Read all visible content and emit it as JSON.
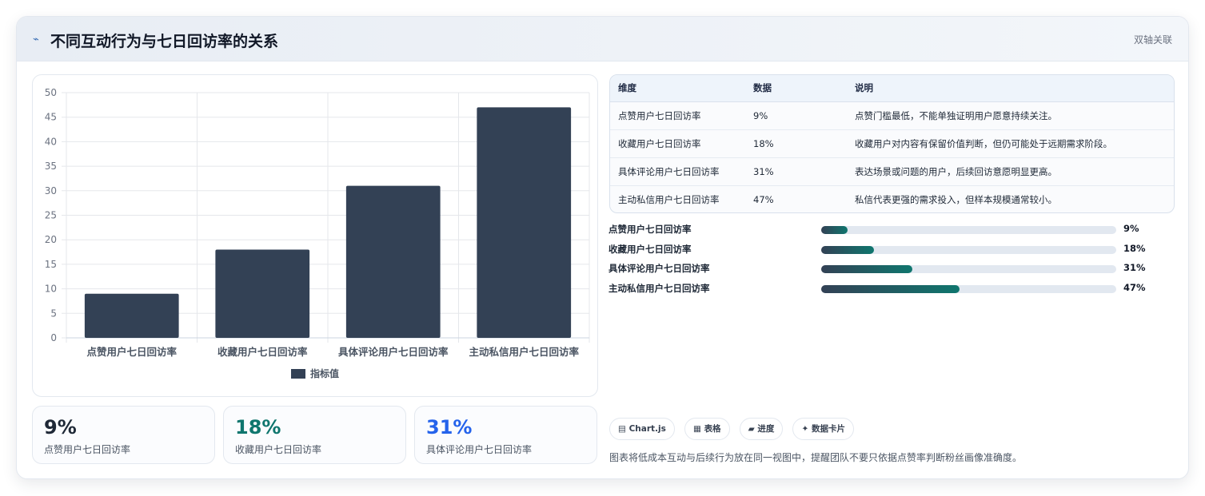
{
  "header": {
    "title": "不同互动行为与七日回访率的关系",
    "tag": "双轴关联",
    "icon": "pulse-icon"
  },
  "chart_data": {
    "type": "bar",
    "categories": [
      "点赞用户七日回访率",
      "收藏用户七日回访率",
      "具体评论用户七日回访率",
      "主动私信用户七日回访率"
    ],
    "series": [
      {
        "name": "指标值",
        "values": [
          9,
          18,
          31,
          47
        ]
      }
    ],
    "ylim": [
      0,
      50
    ],
    "yticks": [
      0,
      5,
      10,
      15,
      20,
      25,
      30,
      35,
      40,
      45,
      50
    ],
    "grid": true,
    "legend": "bottom",
    "bar_color": "#334155"
  },
  "kpis": [
    {
      "value": "9%",
      "label": "点赞用户七日回访率",
      "color": "#1f2937"
    },
    {
      "value": "18%",
      "label": "收藏用户七日回访率",
      "color": "#0f766e"
    },
    {
      "value": "31%",
      "label": "具体评论用户七日回访率",
      "color": "#2563eb"
    }
  ],
  "table": {
    "headers": [
      "维度",
      "数据",
      "说明"
    ],
    "rows": [
      [
        "点赞用户七日回访率",
        "9%",
        "点赞门槛最低，不能单独证明用户愿意持续关注。"
      ],
      [
        "收藏用户七日回访率",
        "18%",
        "收藏用户对内容有保留价值判断，但仍可能处于远期需求阶段。"
      ],
      [
        "具体评论用户七日回访率",
        "31%",
        "表达场景或问题的用户，后续回访意愿明显更高。"
      ],
      [
        "主动私信用户七日回访率",
        "47%",
        "私信代表更强的需求投入，但样本规模通常较小。"
      ]
    ]
  },
  "progress": [
    {
      "label": "点赞用户七日回访率",
      "value": "9%",
      "percent": 9
    },
    {
      "label": "收藏用户七日回访率",
      "value": "18%",
      "percent": 18
    },
    {
      "label": "具体评论用户七日回访率",
      "value": "31%",
      "percent": 31
    },
    {
      "label": "主动私信用户七日回访率",
      "value": "47%",
      "percent": 47
    }
  ],
  "chips": [
    {
      "icon": "chart-icon",
      "glyph": "▤",
      "label": "Chart.js"
    },
    {
      "icon": "table-icon",
      "glyph": "▦",
      "label": "表格"
    },
    {
      "icon": "progress-icon",
      "glyph": "▰",
      "label": "进度"
    },
    {
      "icon": "card-icon",
      "glyph": "✦",
      "label": "数据卡片"
    }
  ],
  "note": "图表将低成本互动与后续行为放在同一视图中，提醒团队不要只依据点赞率判断粉丝画像准确度。"
}
